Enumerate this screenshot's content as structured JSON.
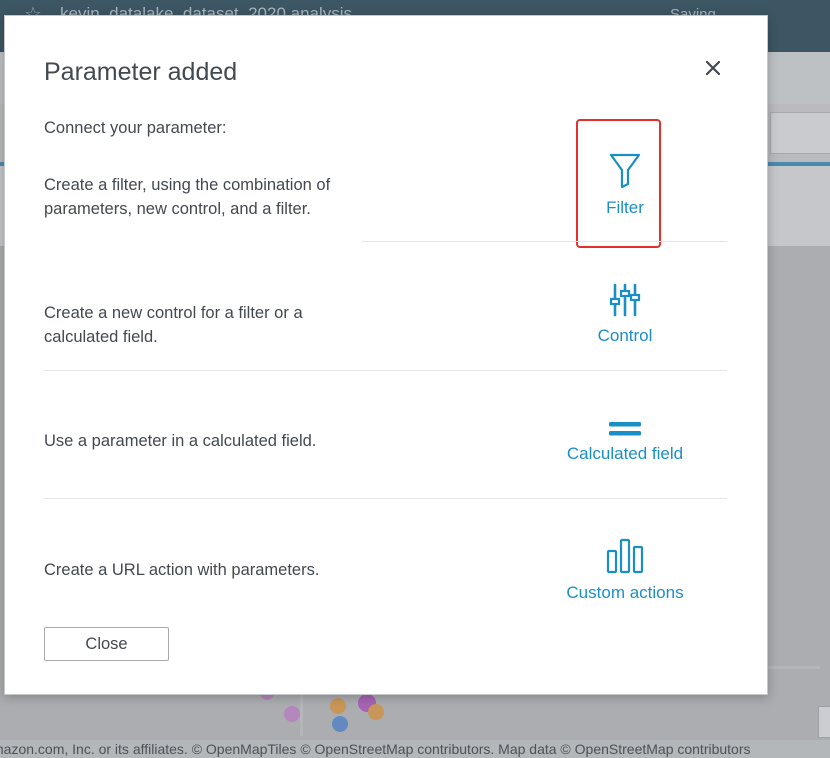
{
  "background": {
    "analysis_title": "kevin_datalake_dataset_2020 analysis",
    "saving_status": "Saving",
    "map_attribution": "mazon.com, Inc. or its affiliates. © OpenMapTiles © OpenStreetMap contributors. Map data © OpenStreetMap contributors"
  },
  "modal": {
    "title": "Parameter added",
    "close_symbol": "×",
    "intro": "Connect your parameter:",
    "rows": [
      {
        "description": "Create a filter, using the combination of parameters, new control, and a filter.",
        "action_label": "Filter",
        "icon": "filter-funnel-icon"
      },
      {
        "description": "Create a new control for a filter or a calculated field.",
        "action_label": "Control",
        "icon": "sliders-icon"
      },
      {
        "description": "Use a parameter in a calculated field.",
        "action_label": "Calculated field",
        "icon": "equals-icon"
      },
      {
        "description": "Create a URL action with parameters.",
        "action_label": "Custom actions",
        "icon": "bar-chart-icon"
      }
    ],
    "close_button_label": "Close"
  },
  "colors": {
    "accent": "#1a8fc7",
    "highlight_border": "#e3302a",
    "text": "#424950"
  }
}
